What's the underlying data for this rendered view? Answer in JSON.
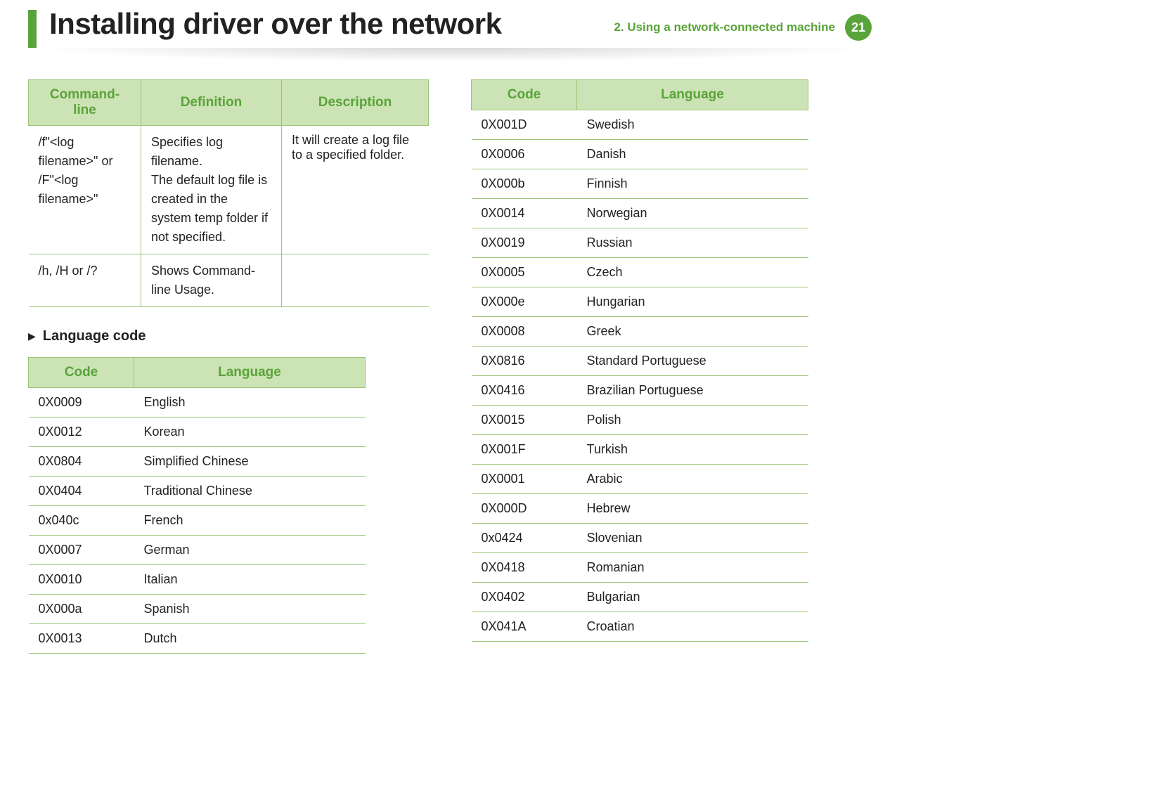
{
  "header": {
    "title": "Installing driver over the network",
    "chapter": "2.  Using a network-connected machine",
    "page_number": "21"
  },
  "command_table": {
    "headers": [
      "Command- line",
      "Definition",
      "Description"
    ],
    "rows": [
      {
        "cmd": "/f\"<log filename>\" or\n/F\"<log filename>\"",
        "def": "Specifies log filename.\nThe default log file is created in the system temp folder if not specified.",
        "desc": "It will create a log file to a specified folder."
      },
      {
        "cmd": "/h, /H or /?",
        "def": "Shows Command-line Usage.",
        "desc": ""
      }
    ]
  },
  "section_heading": "Language code",
  "lang_table": {
    "headers": [
      "Code",
      "Language"
    ],
    "left_rows": [
      {
        "code": "0X0009",
        "lang": "English"
      },
      {
        "code": "0X0012",
        "lang": "Korean"
      },
      {
        "code": "0X0804",
        "lang": "Simplified Chinese"
      },
      {
        "code": "0X0404",
        "lang": "Traditional Chinese"
      },
      {
        "code": "0x040c",
        "lang": "French"
      },
      {
        "code": "0X0007",
        "lang": "German"
      },
      {
        "code": "0X0010",
        "lang": "Italian"
      },
      {
        "code": "0X000a",
        "lang": "Spanish"
      },
      {
        "code": "0X0013",
        "lang": "Dutch"
      }
    ],
    "right_rows": [
      {
        "code": "0X001D",
        "lang": "Swedish"
      },
      {
        "code": "0X0006",
        "lang": "Danish"
      },
      {
        "code": "0X000b",
        "lang": "Finnish"
      },
      {
        "code": "0X0014",
        "lang": "Norwegian"
      },
      {
        "code": "0X0019",
        "lang": "Russian"
      },
      {
        "code": "0X0005",
        "lang": "Czech"
      },
      {
        "code": "0X000e",
        "lang": "Hungarian"
      },
      {
        "code": "0X0008",
        "lang": "Greek"
      },
      {
        "code": "0X0816",
        "lang": "Standard Portuguese"
      },
      {
        "code": "0X0416",
        "lang": "Brazilian Portuguese"
      },
      {
        "code": "0X0015",
        "lang": "Polish"
      },
      {
        "code": "0X001F",
        "lang": "Turkish"
      },
      {
        "code": "0X0001",
        "lang": "Arabic"
      },
      {
        "code": "0X000D",
        "lang": "Hebrew"
      },
      {
        "code": "0x0424",
        "lang": "Slovenian"
      },
      {
        "code": "0X0418",
        "lang": "Romanian"
      },
      {
        "code": "0X0402",
        "lang": "Bulgarian"
      },
      {
        "code": "0X041A",
        "lang": "Croatian"
      }
    ]
  }
}
